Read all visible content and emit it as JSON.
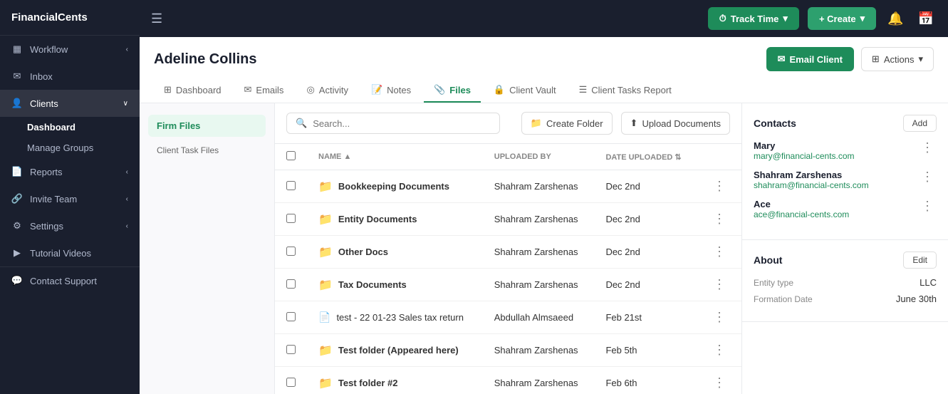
{
  "app": {
    "name": "FinancialCents"
  },
  "topbar": {
    "track_time_label": "Track Time",
    "create_label": "+ Create",
    "chevron": "▾"
  },
  "sidebar": {
    "items": [
      {
        "id": "workflow",
        "label": "Workflow",
        "icon": "📋",
        "has_chevron": true
      },
      {
        "id": "inbox",
        "label": "Inbox",
        "icon": "✉️",
        "has_chevron": false
      },
      {
        "id": "clients",
        "label": "Clients",
        "icon": "👤",
        "has_chevron": true,
        "active": true
      },
      {
        "id": "reports",
        "label": "Reports",
        "icon": "📄",
        "has_chevron": true
      },
      {
        "id": "invite-team",
        "label": "Invite Team",
        "icon": "🔗",
        "has_chevron": true
      },
      {
        "id": "settings",
        "label": "Settings",
        "icon": "⚙️",
        "has_chevron": true
      },
      {
        "id": "tutorial-videos",
        "label": "Tutorial Videos",
        "icon": "▶️",
        "has_chevron": false
      },
      {
        "id": "contact-support",
        "label": "Contact Support",
        "icon": "💬",
        "has_chevron": false
      }
    ],
    "sub_items": [
      {
        "id": "dashboard",
        "label": "Dashboard",
        "active": true
      },
      {
        "id": "manage-groups",
        "label": "Manage Groups",
        "active": false
      }
    ]
  },
  "client": {
    "name": "Adeline Collins"
  },
  "header_actions": {
    "email_client_label": "Email Client",
    "actions_label": "Actions"
  },
  "tabs": [
    {
      "id": "dashboard",
      "label": "Dashboard",
      "icon": "⊞"
    },
    {
      "id": "emails",
      "label": "Emails",
      "icon": "✉"
    },
    {
      "id": "activity",
      "label": "Activity",
      "icon": "◎"
    },
    {
      "id": "notes",
      "label": "Notes",
      "icon": "📝"
    },
    {
      "id": "files",
      "label": "Files",
      "icon": "📎",
      "active": true
    },
    {
      "id": "client-vault",
      "label": "Client Vault",
      "icon": "🔒"
    },
    {
      "id": "client-tasks-report",
      "label": "Client Tasks Report",
      "icon": "☰"
    }
  ],
  "files_sidebar": {
    "items": [
      {
        "id": "firm-files",
        "label": "Firm Files",
        "active": true
      },
      {
        "id": "client-task-files",
        "label": "Client Task Files",
        "active": false
      }
    ]
  },
  "file_toolbar": {
    "search_placeholder": "Search...",
    "create_folder_label": "Create Folder",
    "upload_label": "Upload Documents"
  },
  "file_table": {
    "headers": [
      {
        "id": "name",
        "label": "NAME ▲"
      },
      {
        "id": "uploaded-by",
        "label": "UPLOADED BY"
      },
      {
        "id": "date-uploaded",
        "label": "DATE UPLOADED ⇅"
      }
    ],
    "rows": [
      {
        "id": 1,
        "name": "Bookkeeping Documents",
        "type": "folder",
        "uploaded_by": "Shahram Zarshenas",
        "date": "Dec 2nd"
      },
      {
        "id": 2,
        "name": "Entity Documents",
        "type": "folder",
        "uploaded_by": "Shahram Zarshenas",
        "date": "Dec 2nd"
      },
      {
        "id": 3,
        "name": "Other Docs",
        "type": "folder",
        "uploaded_by": "Shahram Zarshenas",
        "date": "Dec 2nd"
      },
      {
        "id": 4,
        "name": "Tax Documents",
        "type": "folder",
        "uploaded_by": "Shahram Zarshenas",
        "date": "Dec 2nd"
      },
      {
        "id": 5,
        "name": "test - 22 01-23 Sales tax return",
        "type": "file",
        "uploaded_by": "Abdullah Almsaeed",
        "date": "Feb 21st"
      },
      {
        "id": 6,
        "name": "Test folder (Appeared here)",
        "type": "folder",
        "uploaded_by": "Shahram Zarshenas",
        "date": "Feb 5th"
      },
      {
        "id": 7,
        "name": "Test folder #2",
        "type": "folder",
        "uploaded_by": "Shahram Zarshenas",
        "date": "Feb 6th"
      }
    ]
  },
  "contacts": {
    "title": "Contacts",
    "add_label": "Add",
    "items": [
      {
        "id": 1,
        "name": "Mary",
        "email": "mary@financial-cents.com"
      },
      {
        "id": 2,
        "name": "Shahram Zarshenas",
        "email": "shahram@financial-cents.com"
      },
      {
        "id": 3,
        "name": "Ace",
        "email": "ace@financial-cents.com"
      }
    ]
  },
  "about": {
    "title": "About",
    "edit_label": "Edit",
    "rows": [
      {
        "label": "Entity type",
        "value": "LLC"
      },
      {
        "label": "Formation Date",
        "value": "June 30th"
      }
    ]
  }
}
